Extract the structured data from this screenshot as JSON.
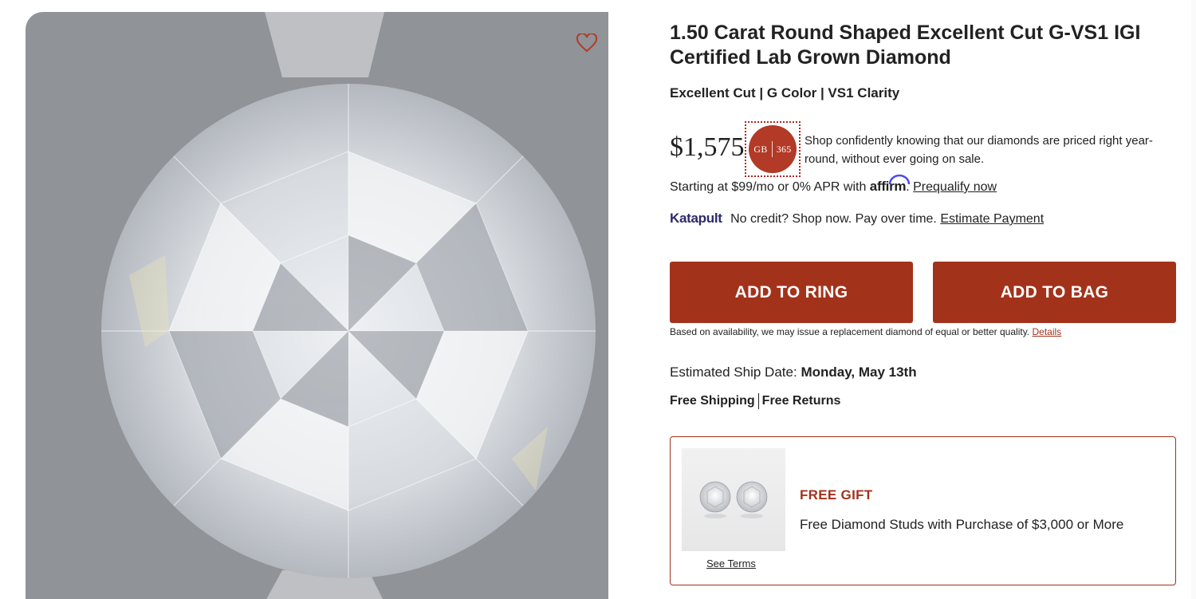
{
  "product": {
    "title": "1.50 Carat Round Shaped Excellent Cut G-VS1 IGI Certified Lab Grown Diamond",
    "subtitle": "Excellent Cut | G Color | VS1 Clarity",
    "price": "$1,575",
    "badge": {
      "left": "GB",
      "right": "365"
    },
    "price_note": "Shop confidently knowing that our diamonds are priced right year-round, without ever going on sale."
  },
  "financing": {
    "affirm_prefix": "Starting at $99/mo or 0% APR with",
    "affirm_logo": "affirm",
    "affirm_link": "Prequalify now",
    "katapult_logo": "Katapult",
    "katapult_text": "No credit? Shop now. Pay over time.",
    "katapult_link": "Estimate Payment"
  },
  "actions": {
    "add_to_ring": "ADD TO RING",
    "add_to_bag": "ADD TO BAG"
  },
  "availability": {
    "text": "Based on availability, we may issue a replacement diamond of equal or better quality.",
    "link": "Details"
  },
  "shipping": {
    "label": "Estimated Ship Date:",
    "date": "Monday, May 13th",
    "free_shipping": "Free Shipping",
    "free_returns": "Free Returns"
  },
  "gift": {
    "title": "FREE GIFT",
    "text": "Free Diamond Studs with Purchase of $3,000 or More",
    "terms_link": "See Terms"
  },
  "icons": {
    "favorite": "heart-icon"
  },
  "colors": {
    "accent": "#a3321b",
    "badge": "#b23a26",
    "katapult": "#2b2a6b",
    "media_bg": "#909397"
  }
}
